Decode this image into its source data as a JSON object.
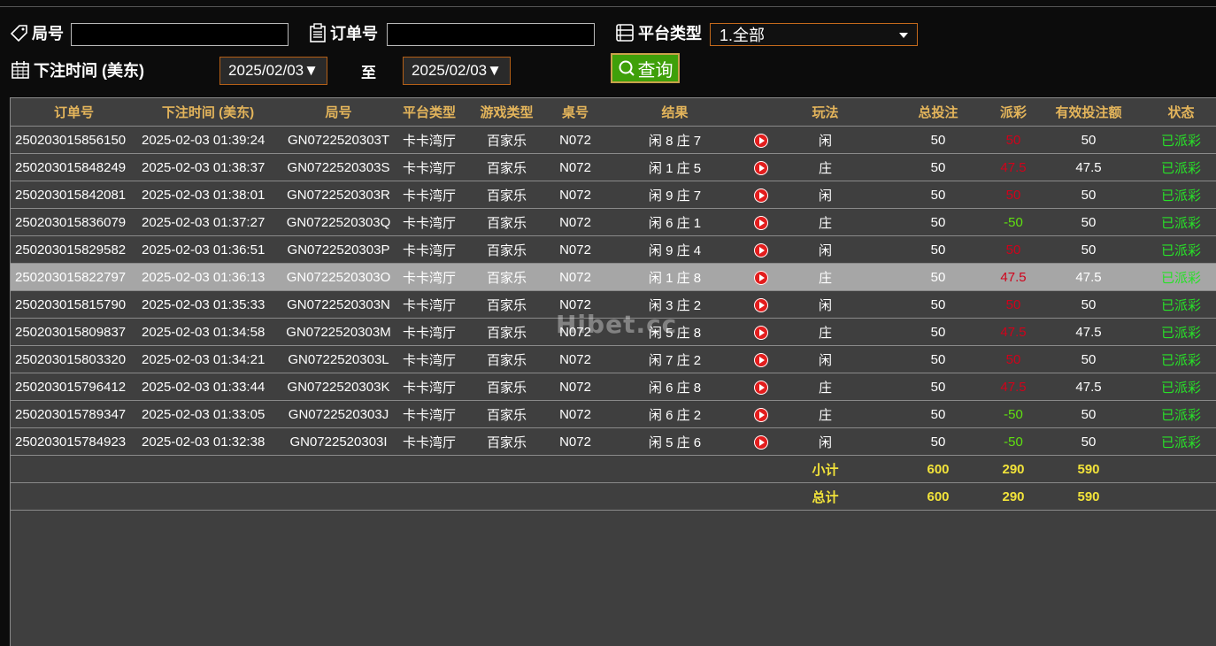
{
  "filters": {
    "round_label": "局号",
    "round_value": "",
    "order_label": "订单号",
    "order_value": "",
    "platform_label": "平台类型",
    "platform_selected": "1.全部",
    "time_label": "下注时间 (美东)",
    "date_from": "2025/02/03▼",
    "to_label": "至",
    "date_to": "2025/02/03▼",
    "query_label": "查询"
  },
  "table": {
    "headers": [
      "订单号",
      "下注时间 (美东)",
      "局号",
      "平台类型",
      "游戏类型",
      "桌号",
      "结果",
      "",
      "玩法",
      "总投注",
      "派彩",
      "有效投注额",
      "状态"
    ],
    "rows": [
      {
        "order": "250203015856150",
        "time": "2025-02-03 01:39:24",
        "round": "GN0722520303T",
        "platform": "卡卡湾厅",
        "game": "百家乐",
        "table": "N072",
        "result": "闲 8 庄 7",
        "play": "闲",
        "bet": "50",
        "payout": "50",
        "payout_color": "red",
        "valid": "50",
        "status": "已派彩"
      },
      {
        "order": "250203015848249",
        "time": "2025-02-03 01:38:37",
        "round": "GN0722520303S",
        "platform": "卡卡湾厅",
        "game": "百家乐",
        "table": "N072",
        "result": "闲 1 庄 5",
        "play": "庄",
        "bet": "50",
        "payout": "47.5",
        "payout_color": "red",
        "valid": "47.5",
        "status": "已派彩"
      },
      {
        "order": "250203015842081",
        "time": "2025-02-03 01:38:01",
        "round": "GN0722520303R",
        "platform": "卡卡湾厅",
        "game": "百家乐",
        "table": "N072",
        "result": "闲 9 庄 7",
        "play": "闲",
        "bet": "50",
        "payout": "50",
        "payout_color": "red",
        "valid": "50",
        "status": "已派彩"
      },
      {
        "order": "250203015836079",
        "time": "2025-02-03 01:37:27",
        "round": "GN0722520303Q",
        "platform": "卡卡湾厅",
        "game": "百家乐",
        "table": "N072",
        "result": "闲 6 庄 1",
        "play": "庄",
        "bet": "50",
        "payout": "-50",
        "payout_color": "green",
        "valid": "50",
        "status": "已派彩"
      },
      {
        "order": "250203015829582",
        "time": "2025-02-03 01:36:51",
        "round": "GN0722520303P",
        "platform": "卡卡湾厅",
        "game": "百家乐",
        "table": "N072",
        "result": "闲 9 庄 4",
        "play": "闲",
        "bet": "50",
        "payout": "50",
        "payout_color": "red",
        "valid": "50",
        "status": "已派彩"
      },
      {
        "order": "250203015822797",
        "time": "2025-02-03 01:36:13",
        "round": "GN0722520303O",
        "platform": "卡卡湾厅",
        "game": "百家乐",
        "table": "N072",
        "result": "闲 1 庄 8",
        "play": "庄",
        "bet": "50",
        "payout": "47.5",
        "payout_color": "red",
        "valid": "47.5",
        "status": "已派彩",
        "highlight": true
      },
      {
        "order": "250203015815790",
        "time": "2025-02-03 01:35:33",
        "round": "GN0722520303N",
        "platform": "卡卡湾厅",
        "game": "百家乐",
        "table": "N072",
        "result": "闲 3 庄 2",
        "play": "闲",
        "bet": "50",
        "payout": "50",
        "payout_color": "red",
        "valid": "50",
        "status": "已派彩"
      },
      {
        "order": "250203015809837",
        "time": "2025-02-03 01:34:58",
        "round": "GN0722520303M",
        "platform": "卡卡湾厅",
        "game": "百家乐",
        "table": "N072",
        "result": "闲 5 庄 8",
        "play": "庄",
        "bet": "50",
        "payout": "47.5",
        "payout_color": "red",
        "valid": "47.5",
        "status": "已派彩"
      },
      {
        "order": "250203015803320",
        "time": "2025-02-03 01:34:21",
        "round": "GN0722520303L",
        "platform": "卡卡湾厅",
        "game": "百家乐",
        "table": "N072",
        "result": "闲 7 庄 2",
        "play": "闲",
        "bet": "50",
        "payout": "50",
        "payout_color": "red",
        "valid": "50",
        "status": "已派彩"
      },
      {
        "order": "250203015796412",
        "time": "2025-02-03 01:33:44",
        "round": "GN0722520303K",
        "platform": "卡卡湾厅",
        "game": "百家乐",
        "table": "N072",
        "result": "闲 6 庄 8",
        "play": "庄",
        "bet": "50",
        "payout": "47.5",
        "payout_color": "red",
        "valid": "47.5",
        "status": "已派彩"
      },
      {
        "order": "250203015789347",
        "time": "2025-02-03 01:33:05",
        "round": "GN0722520303J",
        "platform": "卡卡湾厅",
        "game": "百家乐",
        "table": "N072",
        "result": "闲 6 庄 2",
        "play": "庄",
        "bet": "50",
        "payout": "-50",
        "payout_color": "green",
        "valid": "50",
        "status": "已派彩"
      },
      {
        "order": "250203015784923",
        "time": "2025-02-03 01:32:38",
        "round": "GN0722520303I",
        "platform": "卡卡湾厅",
        "game": "百家乐",
        "table": "N072",
        "result": "闲 5 庄 6",
        "play": "闲",
        "bet": "50",
        "payout": "-50",
        "payout_color": "green",
        "valid": "50",
        "status": "已派彩"
      }
    ],
    "subtotal": {
      "label": "小计",
      "bet": "600",
      "payout": "290",
      "valid": "590"
    },
    "total": {
      "label": "总计",
      "bet": "600",
      "payout": "290",
      "valid": "590"
    }
  },
  "watermark": "Hibet.cc",
  "colors": {
    "header_text": "#e4b55b",
    "payout_win": "#d0021b",
    "payout_loss": "#5fe010",
    "status": "#28e028",
    "sum_text": "#f2e33a",
    "query_button": "#3fa00a"
  }
}
